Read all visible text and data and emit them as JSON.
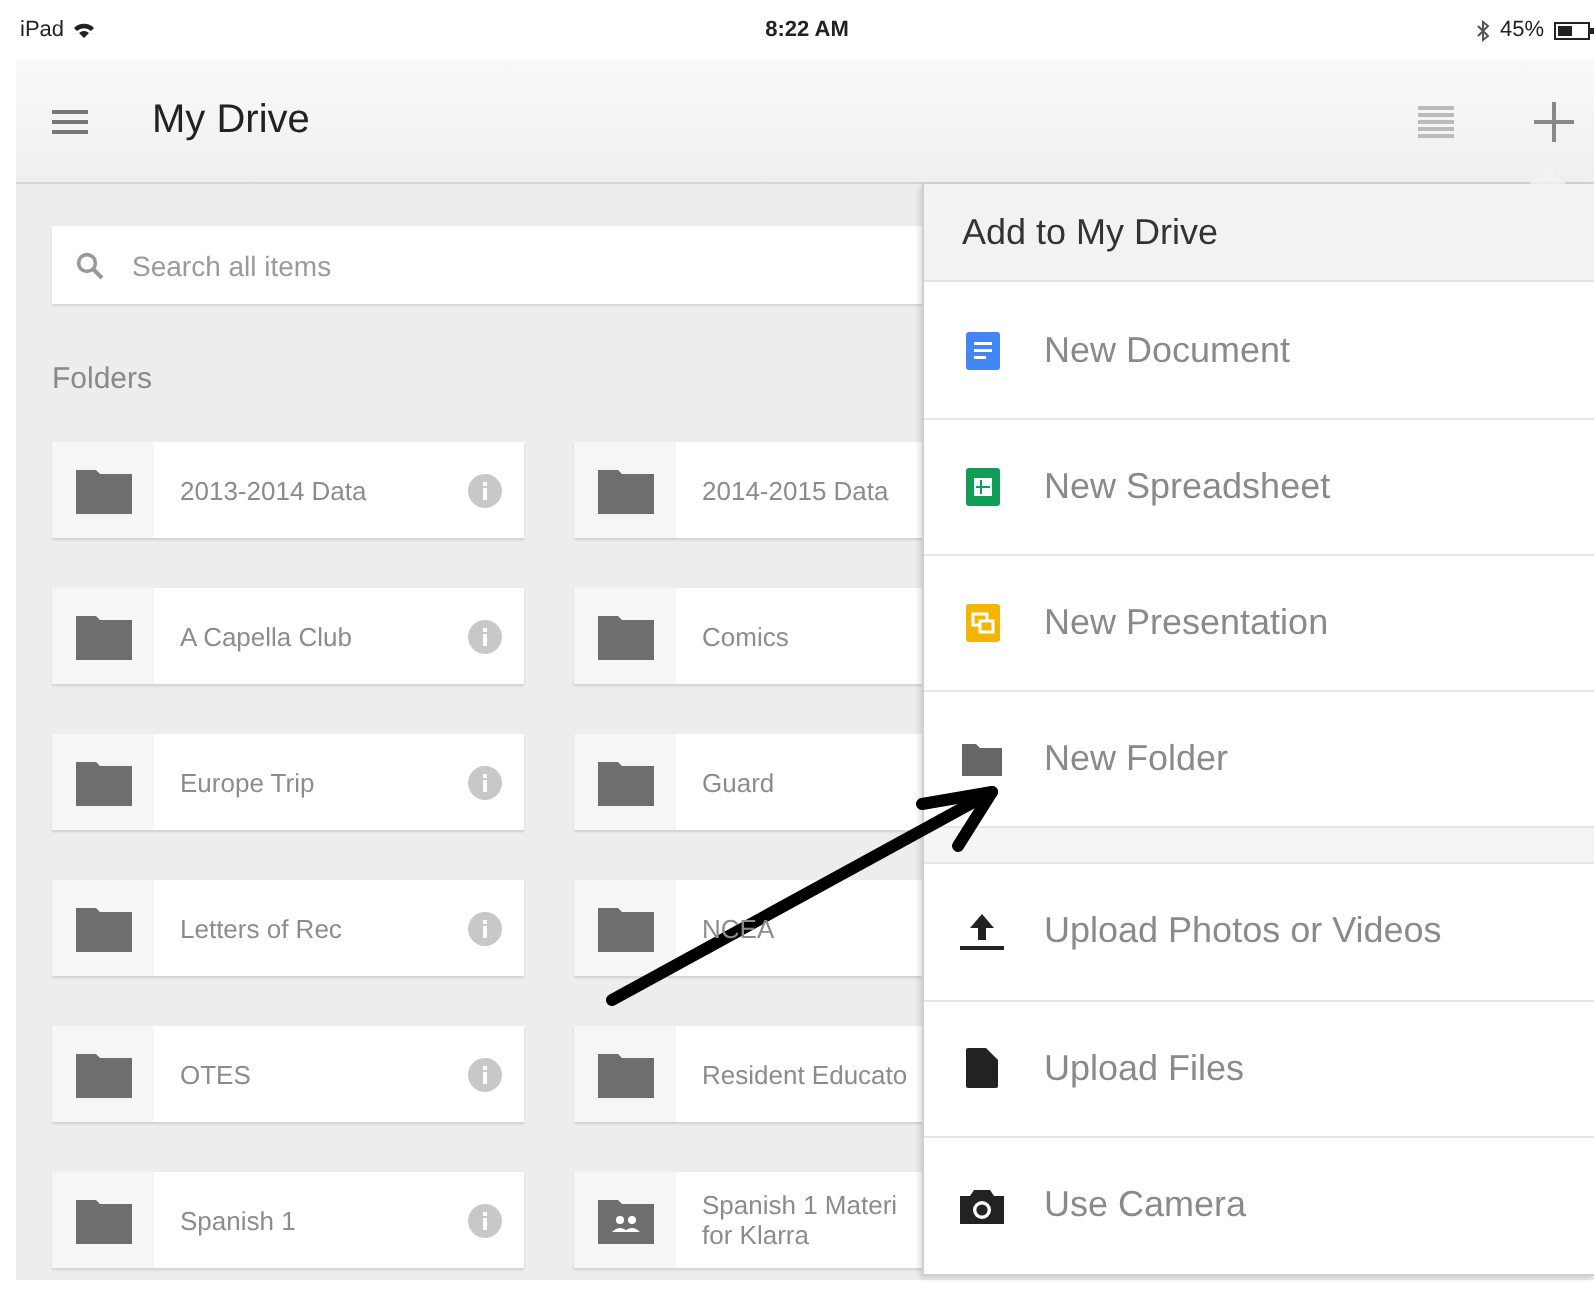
{
  "status_bar": {
    "device": "iPad",
    "time": "8:22 AM",
    "battery": "45%"
  },
  "header": {
    "title": "My Drive"
  },
  "search": {
    "placeholder": "Search all items"
  },
  "folders_heading": "Folders",
  "folder_rows": [
    [
      {
        "name": "2013-2014 Data",
        "shared": false,
        "info_button": true
      },
      {
        "name": "2014-2015 Data",
        "shared": false,
        "info_button": false
      }
    ],
    [
      {
        "name": "A Capella Club",
        "shared": false,
        "info_button": true
      },
      {
        "name": "Comics",
        "shared": false,
        "info_button": false
      }
    ],
    [
      {
        "name": "Europe Trip",
        "shared": false,
        "info_button": true
      },
      {
        "name": "Guard",
        "shared": false,
        "info_button": false
      }
    ],
    [
      {
        "name": "Letters of Rec",
        "shared": false,
        "info_button": true
      },
      {
        "name": "NCEA",
        "shared": false,
        "info_button": false
      }
    ],
    [
      {
        "name": "OTES",
        "shared": false,
        "info_button": true
      },
      {
        "name": "Resident Educato",
        "shared": false,
        "info_button": false
      }
    ],
    [
      {
        "name": "Spanish 1",
        "shared": false,
        "info_button": true
      },
      {
        "name": "Spanish 1 Materi for Klarra",
        "shared": true,
        "info_button": false
      }
    ]
  ],
  "add_menu": {
    "title": "Add to My Drive",
    "sections": [
      [
        {
          "kind": "document",
          "label": "New Document"
        },
        {
          "kind": "spreadsheet",
          "label": "New Spreadsheet"
        },
        {
          "kind": "presentation",
          "label": "New Presentation"
        },
        {
          "kind": "folder",
          "label": "New Folder"
        }
      ],
      [
        {
          "kind": "upload",
          "label": "Upload Photos or Videos"
        },
        {
          "kind": "file",
          "label": "Upload Files"
        },
        {
          "kind": "camera",
          "label": "Use Camera"
        }
      ]
    ]
  }
}
